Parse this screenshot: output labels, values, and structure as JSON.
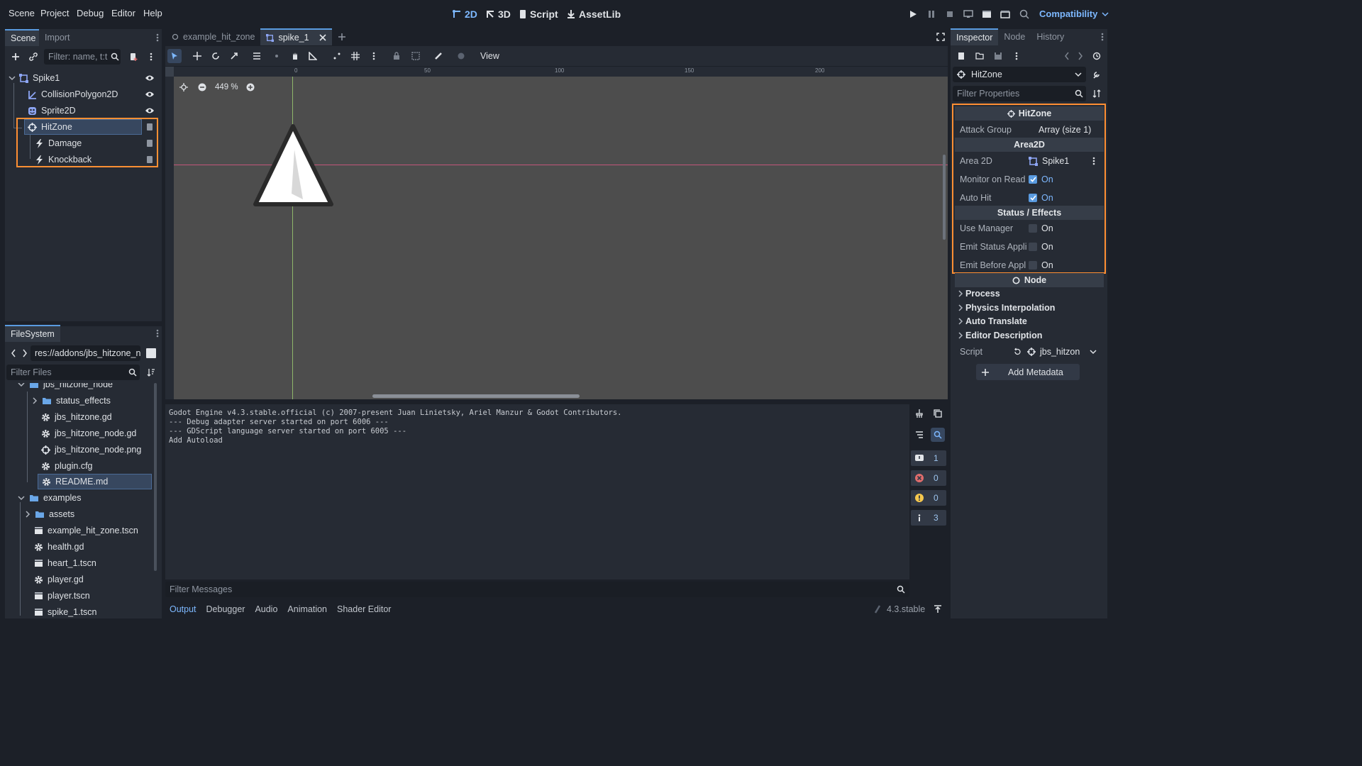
{
  "menu": {
    "scene": "Scene",
    "project": "Project",
    "debug": "Debug",
    "editor": "Editor",
    "help": "Help"
  },
  "main_buttons": {
    "b2d": "2D",
    "b3d": "3D",
    "script": "Script",
    "assetlib": "AssetLib"
  },
  "renderer": "Compatibility",
  "scene_dock": {
    "tabs": [
      "Scene",
      "Import"
    ],
    "filter_placeholder": "Filter: name, t:t",
    "tree": [
      {
        "label": "Spike1",
        "icon": "node2d-icon"
      },
      {
        "label": "CollisionPolygon2D",
        "icon": "collision-polygon-icon"
      },
      {
        "label": "Sprite2D",
        "icon": "sprite-icon"
      },
      {
        "label": "HitZone",
        "icon": "hitzone-icon"
      },
      {
        "label": "Damage",
        "icon": "lightning-icon"
      },
      {
        "label": "Knockback",
        "icon": "lightning-icon"
      }
    ]
  },
  "filesystem": {
    "tab": "FileSystem",
    "path": "res://addons/jbs_hitzone_n",
    "filter_placeholder": "Filter Files",
    "items": [
      {
        "label": "jbs_hitzone_node",
        "type": "folder"
      },
      {
        "label": "status_effects",
        "type": "folder"
      },
      {
        "label": "jbs_hitzone.gd",
        "type": "gear"
      },
      {
        "label": "jbs_hitzone_node.gd",
        "type": "gear"
      },
      {
        "label": "jbs_hitzone_node.png",
        "type": "target"
      },
      {
        "label": "plugin.cfg",
        "type": "gear"
      },
      {
        "label": "README.md",
        "type": "gear"
      },
      {
        "label": "examples",
        "type": "folder"
      },
      {
        "label": "assets",
        "type": "folder"
      },
      {
        "label": "example_hit_zone.tscn",
        "type": "scene"
      },
      {
        "label": "health.gd",
        "type": "gear"
      },
      {
        "label": "heart_1.tscn",
        "type": "scene"
      },
      {
        "label": "player.gd",
        "type": "gear"
      },
      {
        "label": "player.tscn",
        "type": "scene"
      },
      {
        "label": "spike_1.tscn",
        "type": "scene"
      }
    ]
  },
  "editor_tabs": [
    "example_hit_zone",
    "spike_1"
  ],
  "toolbar": {
    "view": "View"
  },
  "zoom": "449 %",
  "ruler_ticks": [
    "0",
    "50",
    "100",
    "150",
    "200"
  ],
  "output": {
    "lines": [
      "Godot Engine v4.3.stable.official (c) 2007-present Juan Linietsky, Ariel Manzur & Godot Contributors.",
      "--- Debug adapter server started on port 6006 ---",
      "--- GDScript language server started on port 6005 ---",
      "Add Autoload"
    ],
    "filter_placeholder": "Filter Messages",
    "counts": {
      "messages": "1",
      "errors": "0",
      "warnings": "0",
      "info": "3"
    }
  },
  "bottom_tabs": [
    "Output",
    "Debugger",
    "Audio",
    "Animation",
    "Shader Editor"
  ],
  "version": "4.3.stable",
  "inspector": {
    "tabs": [
      "Inspector",
      "Node",
      "History"
    ],
    "object": "HitZone",
    "filter_placeholder": "Filter Properties",
    "cat_hitzone": "HitZone",
    "attack_group_label": "Attack Group",
    "attack_group_value": "Array (size 1)",
    "cat_area2d": "Area2D",
    "area2d_label": "Area 2D",
    "area2d_value": "Spike1",
    "monitor_label": "Monitor on Read",
    "monitor_value": "On",
    "autohit_label": "Auto Hit",
    "autohit_value": "On",
    "cat_status": "Status / Effects",
    "use_manager_label": "Use Manager",
    "use_manager_value": "On",
    "emit_status_label": "Emit Status Appli",
    "emit_status_value": "On",
    "emit_before_label": "Emit Before Appl",
    "emit_before_value": "On",
    "cat_node": "Node",
    "sections": [
      "Process",
      "Physics Interpolation",
      "Auto Translate",
      "Editor Description"
    ],
    "script_label": "Script",
    "script_value": "jbs_hitzon",
    "add_metadata": "Add Metadata"
  }
}
